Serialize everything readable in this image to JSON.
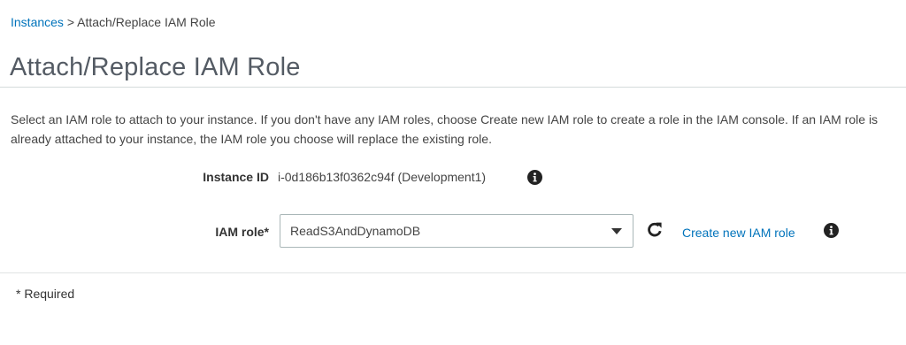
{
  "breadcrumb": {
    "link": "Instances",
    "separator": " > ",
    "current": "Attach/Replace IAM Role"
  },
  "page_title": "Attach/Replace IAM Role",
  "description": "Select an IAM role to attach to your instance. If you don't have any IAM roles, choose Create new IAM role to create a role in the IAM console. If an IAM role is already attached to your instance, the IAM role you choose will replace the existing role.",
  "instance": {
    "label": "Instance ID",
    "value": "i-0d186b13f0362c94f (Development1)",
    "info_icon": "info-icon"
  },
  "iam_role": {
    "label": "IAM role*",
    "selected": "ReadS3AndDynamoDB",
    "refresh_icon": "refresh-icon",
    "create_link": "Create new IAM role",
    "info_icon": "info-icon"
  },
  "required_note": "* Required",
  "colors": {
    "link": "#0073bb",
    "title": "#545b64",
    "text": "#444444",
    "divider": "#d5dbdb"
  }
}
